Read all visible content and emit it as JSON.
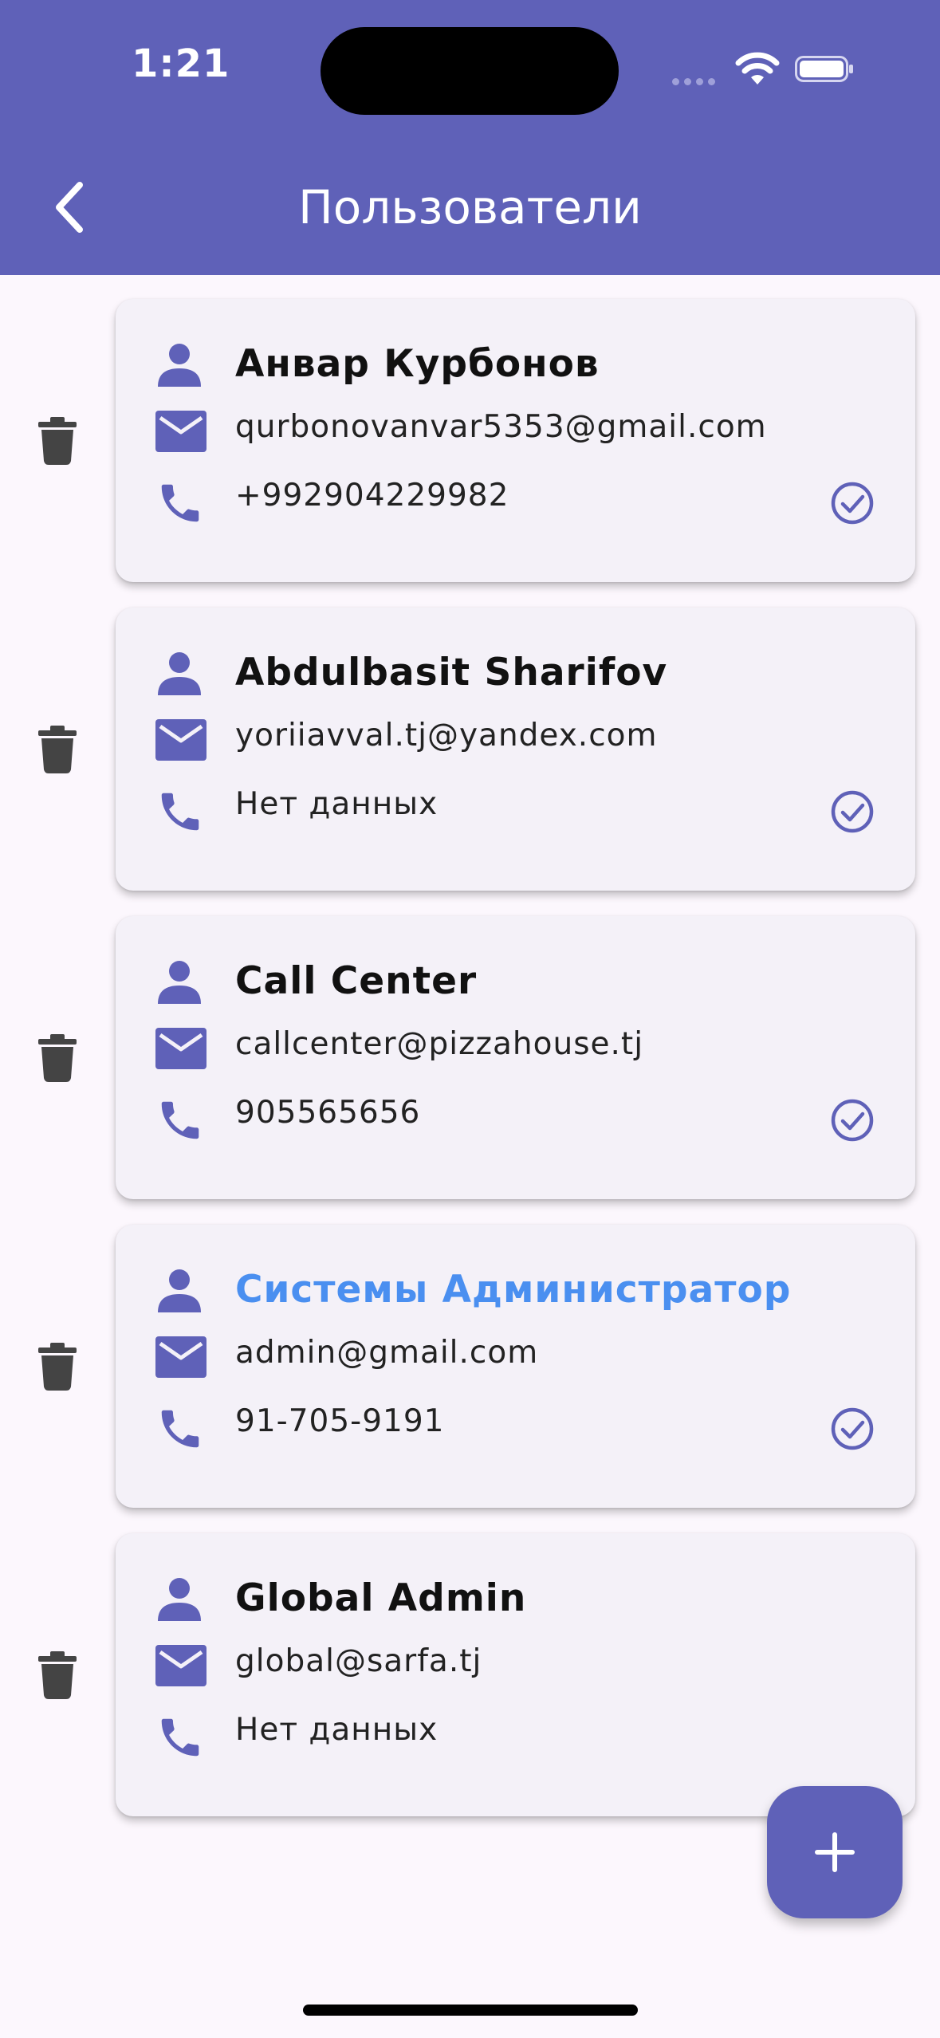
{
  "status_bar": {
    "time": "1:21"
  },
  "header": {
    "title": "Пользователи"
  },
  "colors": {
    "primary": "#5f61b8",
    "admin_name": "#4a8ff0",
    "card": "#f4f1f8",
    "background": "#fcf7fd"
  },
  "users": [
    {
      "name": "Анвар Курбонов",
      "email": "qurbonovanvar5353@gmail.com",
      "phone": "+992904229982",
      "verified": true
    },
    {
      "name": "Abdulbasit Sharifov",
      "email": "yoriiavval.tj@yandex.com",
      "phone": "Нет данных",
      "verified": true
    },
    {
      "name": "Call Center",
      "email": "callcenter@pizzahouse.tj",
      "phone": "905565656",
      "verified": true
    },
    {
      "name": "Системы Администратор",
      "email": "admin@gmail.com",
      "phone": "91-705-9191",
      "verified": true,
      "highlighted": true
    },
    {
      "name": "Global Admin",
      "email": "global@sarfa.tj",
      "phone": "Нет данных",
      "verified": false
    }
  ],
  "icons": {
    "back": "chevron-left-icon",
    "delete": "trash-icon",
    "person": "person-icon",
    "email": "mail-icon",
    "phone": "phone-icon",
    "verified": "check-circle-icon",
    "add": "plus-icon"
  }
}
